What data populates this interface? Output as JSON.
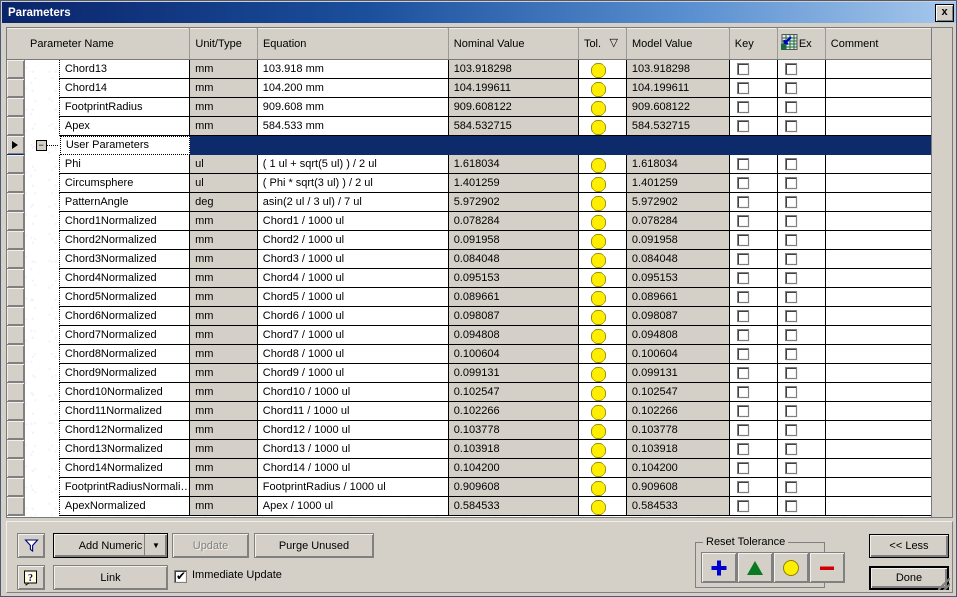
{
  "window": {
    "title": "Parameters",
    "close_label": "x"
  },
  "grid": {
    "columns": [
      {
        "label": "Parameter Name",
        "key": "name"
      },
      {
        "label": "Unit/Type",
        "key": "unit"
      },
      {
        "label": "Equation",
        "key": "equation"
      },
      {
        "label": "Nominal Value",
        "key": "nominal"
      },
      {
        "label": "Tol.",
        "key": "tol",
        "sort_indicator": "▽"
      },
      {
        "label": "Model Value",
        "key": "model"
      },
      {
        "label": "Key",
        "key": "key"
      },
      {
        "label": "Ex",
        "key": "ex",
        "icon": "export-to-spreadsheet-icon"
      },
      {
        "label": "Comment",
        "key": "comment"
      }
    ],
    "rows": [
      {
        "type": "leaf",
        "name": "Chord13",
        "unit": "mm",
        "equation": "103.918 mm",
        "nominal": "103.918298",
        "tol": "yellow-dot",
        "model": "103.918298",
        "key": false,
        "ex": false,
        "comment": ""
      },
      {
        "type": "leaf",
        "name": "Chord14",
        "unit": "mm",
        "equation": "104.200 mm",
        "nominal": "104.199611",
        "tol": "yellow-dot",
        "model": "104.199611",
        "key": false,
        "ex": false,
        "comment": ""
      },
      {
        "type": "leaf",
        "name": "FootprintRadius",
        "unit": "mm",
        "equation": "909.608 mm",
        "nominal": "909.608122",
        "tol": "yellow-dot",
        "model": "909.608122",
        "key": false,
        "ex": false,
        "comment": ""
      },
      {
        "type": "leaf",
        "name": "Apex",
        "unit": "mm",
        "equation": "584.533 mm",
        "nominal": "584.532715",
        "tol": "yellow-dot",
        "model": "584.532715",
        "key": false,
        "ex": false,
        "comment": ""
      },
      {
        "type": "group",
        "selected": true,
        "expander": "−",
        "name": "User Parameters",
        "unit": "",
        "equation": "",
        "nominal": "",
        "tol": "",
        "model": "",
        "key": null,
        "ex": null,
        "comment": ""
      },
      {
        "type": "leaf",
        "name": "Phi",
        "unit": "ul",
        "equation": "( 1 ul + sqrt(5 ul) ) / 2 ul",
        "nominal": "1.618034",
        "tol": "yellow-dot",
        "model": "1.618034",
        "key": false,
        "ex": false,
        "comment": ""
      },
      {
        "type": "leaf",
        "name": "Circumsphere",
        "unit": "ul",
        "equation": "( Phi * sqrt(3 ul) ) / 2 ul",
        "nominal": "1.401259",
        "tol": "yellow-dot",
        "model": "1.401259",
        "key": false,
        "ex": false,
        "comment": ""
      },
      {
        "type": "leaf",
        "name": "PatternAngle",
        "unit": "deg",
        "equation": "asin(2 ul / 3 ul) / 7 ul",
        "nominal": "5.972902",
        "tol": "yellow-dot",
        "model": "5.972902",
        "key": false,
        "ex": false,
        "comment": ""
      },
      {
        "type": "leaf",
        "name": "Chord1Normalized",
        "unit": "mm",
        "equation": "Chord1 / 1000 ul",
        "nominal": "0.078284",
        "tol": "yellow-dot",
        "model": "0.078284",
        "key": false,
        "ex": false,
        "comment": ""
      },
      {
        "type": "leaf",
        "name": "Chord2Normalized",
        "unit": "mm",
        "equation": "Chord2 / 1000 ul",
        "nominal": "0.091958",
        "tol": "yellow-dot",
        "model": "0.091958",
        "key": false,
        "ex": false,
        "comment": ""
      },
      {
        "type": "leaf",
        "name": "Chord3Normalized",
        "unit": "mm",
        "equation": "Chord3 / 1000 ul",
        "nominal": "0.084048",
        "tol": "yellow-dot",
        "model": "0.084048",
        "key": false,
        "ex": false,
        "comment": ""
      },
      {
        "type": "leaf",
        "name": "Chord4Normalized",
        "unit": "mm",
        "equation": "Chord4 / 1000 ul",
        "nominal": "0.095153",
        "tol": "yellow-dot",
        "model": "0.095153",
        "key": false,
        "ex": false,
        "comment": ""
      },
      {
        "type": "leaf",
        "name": "Chord5Normalized",
        "unit": "mm",
        "equation": "Chord5 / 1000 ul",
        "nominal": "0.089661",
        "tol": "yellow-dot",
        "model": "0.089661",
        "key": false,
        "ex": false,
        "comment": ""
      },
      {
        "type": "leaf",
        "name": "Chord6Normalized",
        "unit": "mm",
        "equation": "Chord6 / 1000 ul",
        "nominal": "0.098087",
        "tol": "yellow-dot",
        "model": "0.098087",
        "key": false,
        "ex": false,
        "comment": ""
      },
      {
        "type": "leaf",
        "name": "Chord7Normalized",
        "unit": "mm",
        "equation": "Chord7 / 1000 ul",
        "nominal": "0.094808",
        "tol": "yellow-dot",
        "model": "0.094808",
        "key": false,
        "ex": false,
        "comment": ""
      },
      {
        "type": "leaf",
        "name": "Chord8Normalized",
        "unit": "mm",
        "equation": "Chord8 / 1000 ul",
        "nominal": "0.100604",
        "tol": "yellow-dot",
        "model": "0.100604",
        "key": false,
        "ex": false,
        "comment": ""
      },
      {
        "type": "leaf",
        "name": "Chord9Normalized",
        "unit": "mm",
        "equation": "Chord9 / 1000 ul",
        "nominal": "0.099131",
        "tol": "yellow-dot",
        "model": "0.099131",
        "key": false,
        "ex": false,
        "comment": ""
      },
      {
        "type": "leaf",
        "name": "Chord10Normalized",
        "unit": "mm",
        "equation": "Chord10 / 1000 ul",
        "nominal": "0.102547",
        "tol": "yellow-dot",
        "model": "0.102547",
        "key": false,
        "ex": false,
        "comment": ""
      },
      {
        "type": "leaf",
        "name": "Chord11Normalized",
        "unit": "mm",
        "equation": "Chord11 / 1000 ul",
        "nominal": "0.102266",
        "tol": "yellow-dot",
        "model": "0.102266",
        "key": false,
        "ex": false,
        "comment": ""
      },
      {
        "type": "leaf",
        "name": "Chord12Normalized",
        "unit": "mm",
        "equation": "Chord12 / 1000 ul",
        "nominal": "0.103778",
        "tol": "yellow-dot",
        "model": "0.103778",
        "key": false,
        "ex": false,
        "comment": ""
      },
      {
        "type": "leaf",
        "name": "Chord13Normalized",
        "unit": "mm",
        "equation": "Chord13 / 1000 ul",
        "nominal": "0.103918",
        "tol": "yellow-dot",
        "model": "0.103918",
        "key": false,
        "ex": false,
        "comment": ""
      },
      {
        "type": "leaf",
        "name": "Chord14Normalized",
        "unit": "mm",
        "equation": "Chord14 / 1000 ul",
        "nominal": "0.104200",
        "tol": "yellow-dot",
        "model": "0.104200",
        "key": false,
        "ex": false,
        "comment": ""
      },
      {
        "type": "leaf",
        "name": "FootprintRadiusNormali…",
        "unit": "mm",
        "equation": "FootprintRadius / 1000 ul",
        "nominal": "0.909608",
        "tol": "yellow-dot",
        "model": "0.909608",
        "key": false,
        "ex": false,
        "comment": ""
      },
      {
        "type": "leaf",
        "name": "ApexNormalized",
        "unit": "mm",
        "equation": "Apex / 1000 ul",
        "nominal": "0.584533",
        "tol": "yellow-dot",
        "model": "0.584533",
        "key": false,
        "ex": false,
        "comment": ""
      }
    ]
  },
  "toolbar": {
    "filter_icon": "funnel-filter-icon",
    "help_icon": "help-question-icon",
    "add_numeric_label": "Add Numeric",
    "add_numeric_arrow": "▼",
    "update_label": "Update",
    "update_disabled": true,
    "purge_unused_label": "Purge Unused",
    "link_label": "Link",
    "immediate_update_label": "Immediate Update",
    "immediate_update_checked": true,
    "immediate_update_tick": "✔"
  },
  "reset_tolerance": {
    "legend": "Reset Tolerance",
    "buttons": [
      {
        "name": "plus",
        "glyph": "+",
        "color": "#0000d0"
      },
      {
        "name": "triangle",
        "glyph": "▲",
        "color": "#0a7a22"
      },
      {
        "name": "circle",
        "glyph": "●",
        "color": "#ffee00"
      },
      {
        "name": "minus",
        "glyph": "–",
        "color": "#d00000"
      }
    ]
  },
  "footer": {
    "less_label": "<< Less",
    "done_label": "Done"
  }
}
